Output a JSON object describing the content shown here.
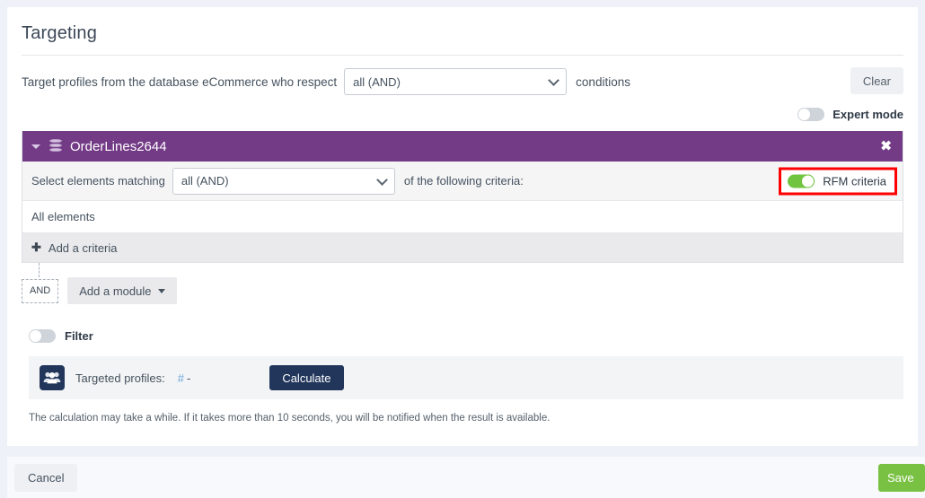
{
  "page": {
    "title": "Targeting"
  },
  "target": {
    "prefix_text": "Target profiles from the database eCommerce who respect",
    "match_value": "all (AND)",
    "suffix_text": "conditions",
    "clear_label": "Clear"
  },
  "expert": {
    "label": "Expert mode",
    "state": "off"
  },
  "module": {
    "title": "OrderLines2644",
    "close_label": "✖",
    "select_label": "Select elements matching",
    "select_value": "all (AND)",
    "following_text": "of the following criteria:",
    "rfm": {
      "label": "RFM criteria",
      "state": "on",
      "highlight_color": "#ff0000"
    },
    "elements_text": "All elements",
    "add_criteria_label": "Add a criteria",
    "add_criteria_icon": "plus-icon"
  },
  "logic": {
    "and_badge": "AND",
    "add_module_label": "Add a module"
  },
  "filter": {
    "label": "Filter",
    "state": "off"
  },
  "profiles": {
    "icon": "people-icon",
    "label": "Targeted profiles:",
    "hash": "#",
    "value": "-",
    "calculate_label": "Calculate"
  },
  "note": {
    "text": "The calculation may take a while. If it takes more than 10 seconds, you will be notified when the result is available."
  },
  "footer": {
    "cancel_label": "Cancel",
    "save_label": "Save"
  },
  "colors": {
    "module_header": "#733a86",
    "toggle_on": "#71c440",
    "save": "#79c143",
    "calculate": "#22365c",
    "highlight": "#ff0000"
  }
}
